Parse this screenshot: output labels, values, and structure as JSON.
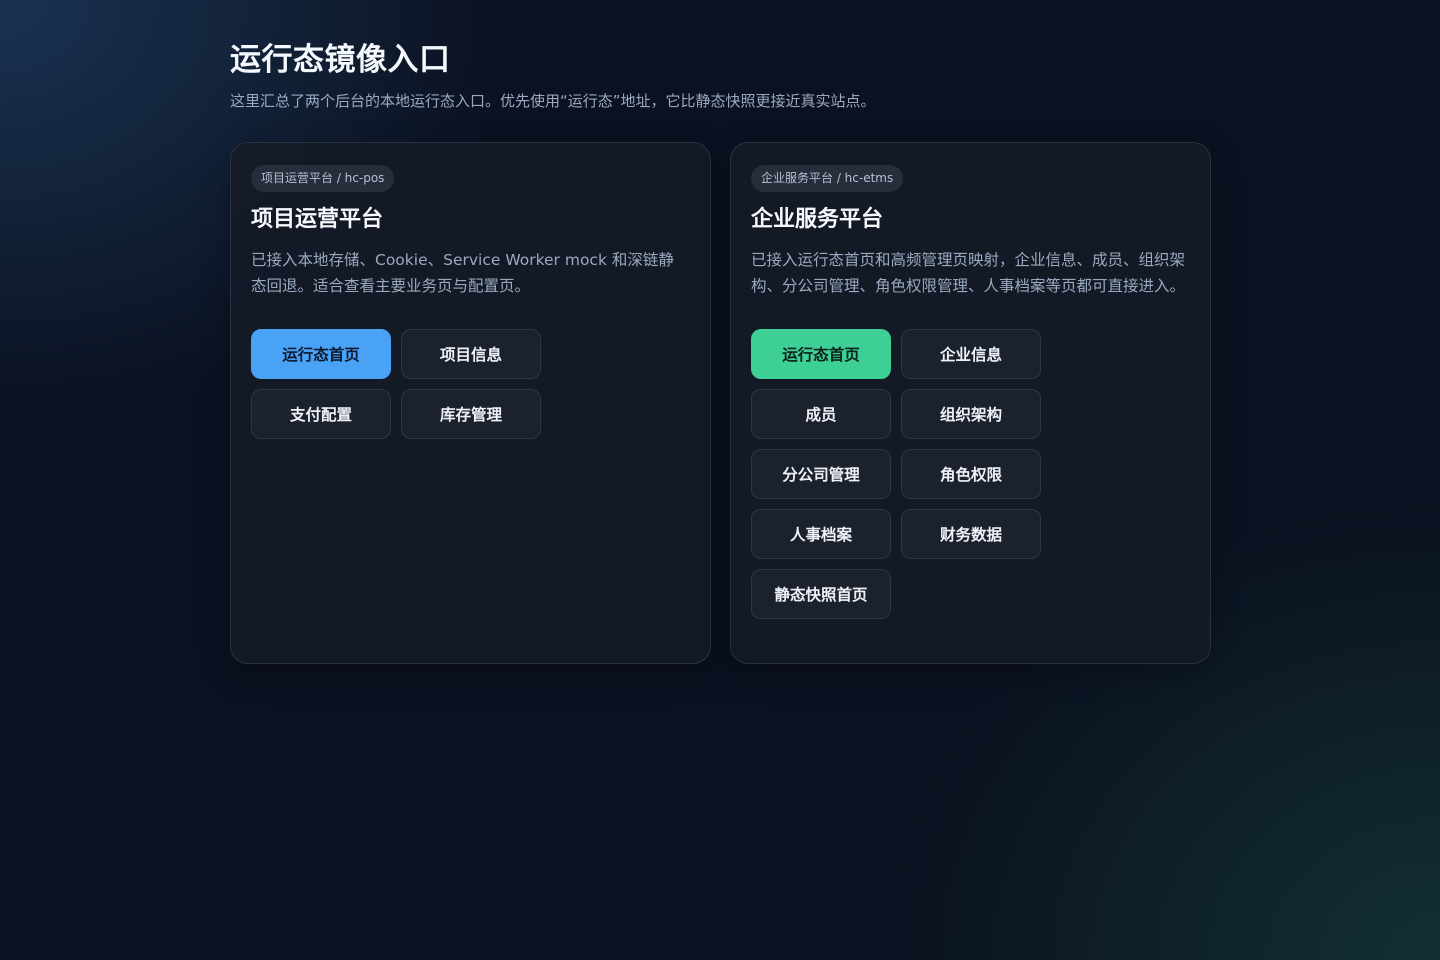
{
  "header": {
    "title": "运行态镜像入口",
    "subtitle": "这里汇总了两个后台的本地运行态入口。优先使用“运行态”地址，它比静态快照更接近真实站点。"
  },
  "cards": [
    {
      "tag": "项目运营平台 / hc-pos",
      "title": "项目运营平台",
      "description": "已接入本地存储、Cookie、Service Worker mock 和深链静态回退。适合查看主要业务页与配置页。",
      "accent_color": "#4aa2f7",
      "buttons": [
        "运行态首页",
        "项目信息",
        "支付配置",
        "库存管理"
      ]
    },
    {
      "tag": "企业服务平台 / hc-etms",
      "title": "企业服务平台",
      "description": "已接入运行态首页和高频管理页映射，企业信息、成员、组织架构、分公司管理、角色权限管理、人事档案等页都可直接进入。",
      "accent_color": "#3dcf95",
      "buttons": [
        "运行态首页",
        "企业信息",
        "成员",
        "组织架构",
        "分公司管理",
        "角色权限",
        "人事档案",
        "财务数据",
        "静态快照首页"
      ]
    }
  ]
}
